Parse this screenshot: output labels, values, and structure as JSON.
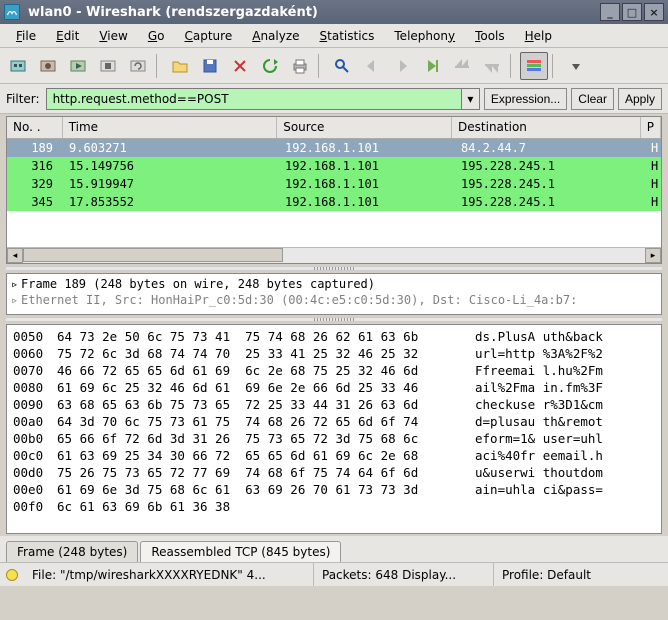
{
  "window": {
    "title": "wlan0 - Wireshark (rendszergazdaként)"
  },
  "menu": {
    "file": "File",
    "edit": "Edit",
    "view": "View",
    "go": "Go",
    "capture": "Capture",
    "analyze": "Analyze",
    "statistics": "Statistics",
    "telephony": "Telephony",
    "tools": "Tools",
    "help": "Help"
  },
  "filter": {
    "label": "Filter:",
    "value": "http.request.method==POST",
    "expression_btn": "Expression...",
    "clear_btn": "Clear",
    "apply_btn": "Apply"
  },
  "packet_list": {
    "headers": {
      "no": "No. .",
      "time": "Time",
      "source": "Source",
      "destination": "Destination",
      "protocol": "P"
    },
    "rows": [
      {
        "no": "189",
        "time": "9.603271",
        "src": "192.168.1.101",
        "dst": "84.2.44.7",
        "proto": "H",
        "cls": "selected"
      },
      {
        "no": "316",
        "time": "15.149756",
        "src": "192.168.1.101",
        "dst": "195.228.245.1",
        "proto": "H",
        "cls": "green"
      },
      {
        "no": "329",
        "time": "15.919947",
        "src": "192.168.1.101",
        "dst": "195.228.245.1",
        "proto": "H",
        "cls": "green"
      },
      {
        "no": "345",
        "time": "17.853552",
        "src": "192.168.1.101",
        "dst": "195.228.245.1",
        "proto": "H",
        "cls": "green"
      }
    ]
  },
  "detail": {
    "line1": "Frame 189 (248 bytes on wire, 248 bytes captured)",
    "line2": "Ethernet II, Src: HonHaiPr_c0:5d:30 (00:4c:e5:c0:5d:30), Dst: Cisco-Li_4a:b7:"
  },
  "hex": [
    {
      "off": "0050",
      "b": "64 73 2e 50 6c 75 73 41  75 74 68 26 62 61 63 6b",
      "a": "ds.PlusA uth&back"
    },
    {
      "off": "0060",
      "b": "75 72 6c 3d 68 74 74 70  25 33 41 25 32 46 25 32",
      "a": "url=http %3A%2F%2"
    },
    {
      "off": "0070",
      "b": "46 66 72 65 65 6d 61 69  6c 2e 68 75 25 32 46 6d",
      "a": "Ffreemai l.hu%2Fm"
    },
    {
      "off": "0080",
      "b": "61 69 6c 25 32 46 6d 61  69 6e 2e 66 6d 25 33 46",
      "a": "ail%2Fma in.fm%3F"
    },
    {
      "off": "0090",
      "b": "63 68 65 63 6b 75 73 65  72 25 33 44 31 26 63 6d",
      "a": "checkuse r%3D1&cm"
    },
    {
      "off": "00a0",
      "b": "64 3d 70 6c 75 73 61 75  74 68 26 72 65 6d 6f 74",
      "a": "d=plusau th&remot"
    },
    {
      "off": "00b0",
      "b": "65 66 6f 72 6d 3d 31 26  75 73 65 72 3d 75 68 6c",
      "a": "eform=1& user=uhl"
    },
    {
      "off": "00c0",
      "b": "61 63 69 25 34 30 66 72  65 65 6d 61 69 6c 2e 68",
      "a": "aci%40fr eemail.h"
    },
    {
      "off": "00d0",
      "b": "75 26 75 73 65 72 77 69  74 68 6f 75 74 64 6f 6d",
      "a": "u&userwi thoutdom"
    },
    {
      "off": "00e0",
      "b": "61 69 6e 3d 75 68 6c 61  63 69 26 70 61 73 73 3d",
      "a": "ain=uhla ci&pass="
    },
    {
      "off": "00f0",
      "b": "6c 61 63 69 6b 61 36 38",
      "a": ""
    }
  ],
  "tabs": {
    "frame": "Frame (248 bytes)",
    "reassembled": "Reassembled TCP (845 bytes)"
  },
  "status": {
    "file": "File: \"/tmp/wiresharkXXXXRYEDNK\" 4...",
    "packets": "Packets: 648 Display...",
    "profile": "Profile: Default"
  }
}
